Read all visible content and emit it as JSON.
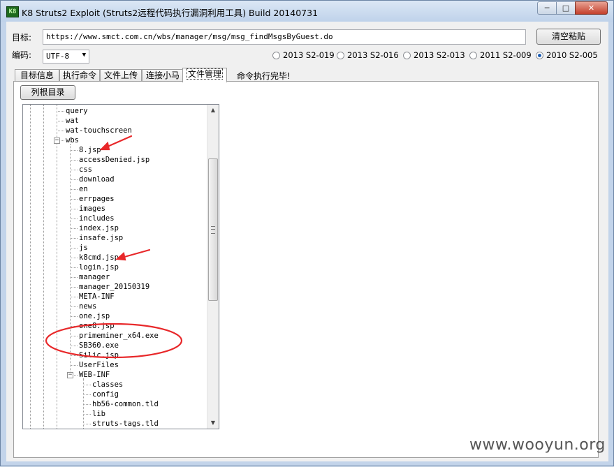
{
  "window": {
    "title": "K8 Struts2 Exploit (Struts2远程代码执行漏洞利用工具)  Build 20140731",
    "icon_label": "K8"
  },
  "window_controls": {
    "minimize": "─",
    "maximize": "□",
    "close": "✕"
  },
  "target": {
    "label": "目标:",
    "url": "https://www.smct.com.cn/wbs/manager/msg/msg_findMsgsByGuest.do",
    "clear_button": "清空粘贴"
  },
  "encoding": {
    "label": "编码:",
    "value": "UTF-8"
  },
  "exploits": [
    {
      "label": "2013 S2-019",
      "checked": false
    },
    {
      "label": "2013 S2-016",
      "checked": false
    },
    {
      "label": "2013 S2-013",
      "checked": false
    },
    {
      "label": "2011 S2-009",
      "checked": false
    },
    {
      "label": "2010 S2-005",
      "checked": true
    }
  ],
  "tabs": [
    {
      "label": "目标信息",
      "active": false
    },
    {
      "label": "执行命令",
      "active": false
    },
    {
      "label": "文件上传",
      "active": false
    },
    {
      "label": "连接小马",
      "active": false
    },
    {
      "label": "文件管理",
      "active": true
    }
  ],
  "status_text": "命令执行完毕!",
  "list_root_button": "列根目录",
  "tree": [
    {
      "label": "query",
      "depth": 2
    },
    {
      "label": "wat",
      "depth": 2
    },
    {
      "label": "wat-touchscreen",
      "depth": 2
    },
    {
      "label": "wbs",
      "depth": 2,
      "expanded": true
    },
    {
      "label": "8.jsp",
      "depth": 3
    },
    {
      "label": "accessDenied.jsp",
      "depth": 3
    },
    {
      "label": "css",
      "depth": 3
    },
    {
      "label": "download",
      "depth": 3
    },
    {
      "label": "en",
      "depth": 3
    },
    {
      "label": "errpages",
      "depth": 3
    },
    {
      "label": "images",
      "depth": 3
    },
    {
      "label": "includes",
      "depth": 3
    },
    {
      "label": "index.jsp",
      "depth": 3
    },
    {
      "label": "insafe.jsp",
      "depth": 3
    },
    {
      "label": "js",
      "depth": 3
    },
    {
      "label": "k8cmd.jsp",
      "depth": 3
    },
    {
      "label": "login.jsp",
      "depth": 3
    },
    {
      "label": "manager",
      "depth": 3
    },
    {
      "label": "manager_20150319",
      "depth": 3
    },
    {
      "label": "META-INF",
      "depth": 3
    },
    {
      "label": "news",
      "depth": 3
    },
    {
      "label": "one.jsp",
      "depth": 3
    },
    {
      "label": "one8.jsp",
      "depth": 3
    },
    {
      "label": "primeminer_x64.exe",
      "depth": 3
    },
    {
      "label": "SB360.exe",
      "depth": 3
    },
    {
      "label": "Silic.jsp",
      "depth": 3
    },
    {
      "label": "UserFiles",
      "depth": 3
    },
    {
      "label": "WEB-INF",
      "depth": 3,
      "expanded": true
    },
    {
      "label": "classes",
      "depth": 4
    },
    {
      "label": "config",
      "depth": 4
    },
    {
      "label": "hb56-common.tld",
      "depth": 4
    },
    {
      "label": "lib",
      "depth": 4
    },
    {
      "label": "struts-tags.tld",
      "depth": 4
    }
  ],
  "annotation_color": "#e8282a",
  "watermark": "www.wooyun.org"
}
